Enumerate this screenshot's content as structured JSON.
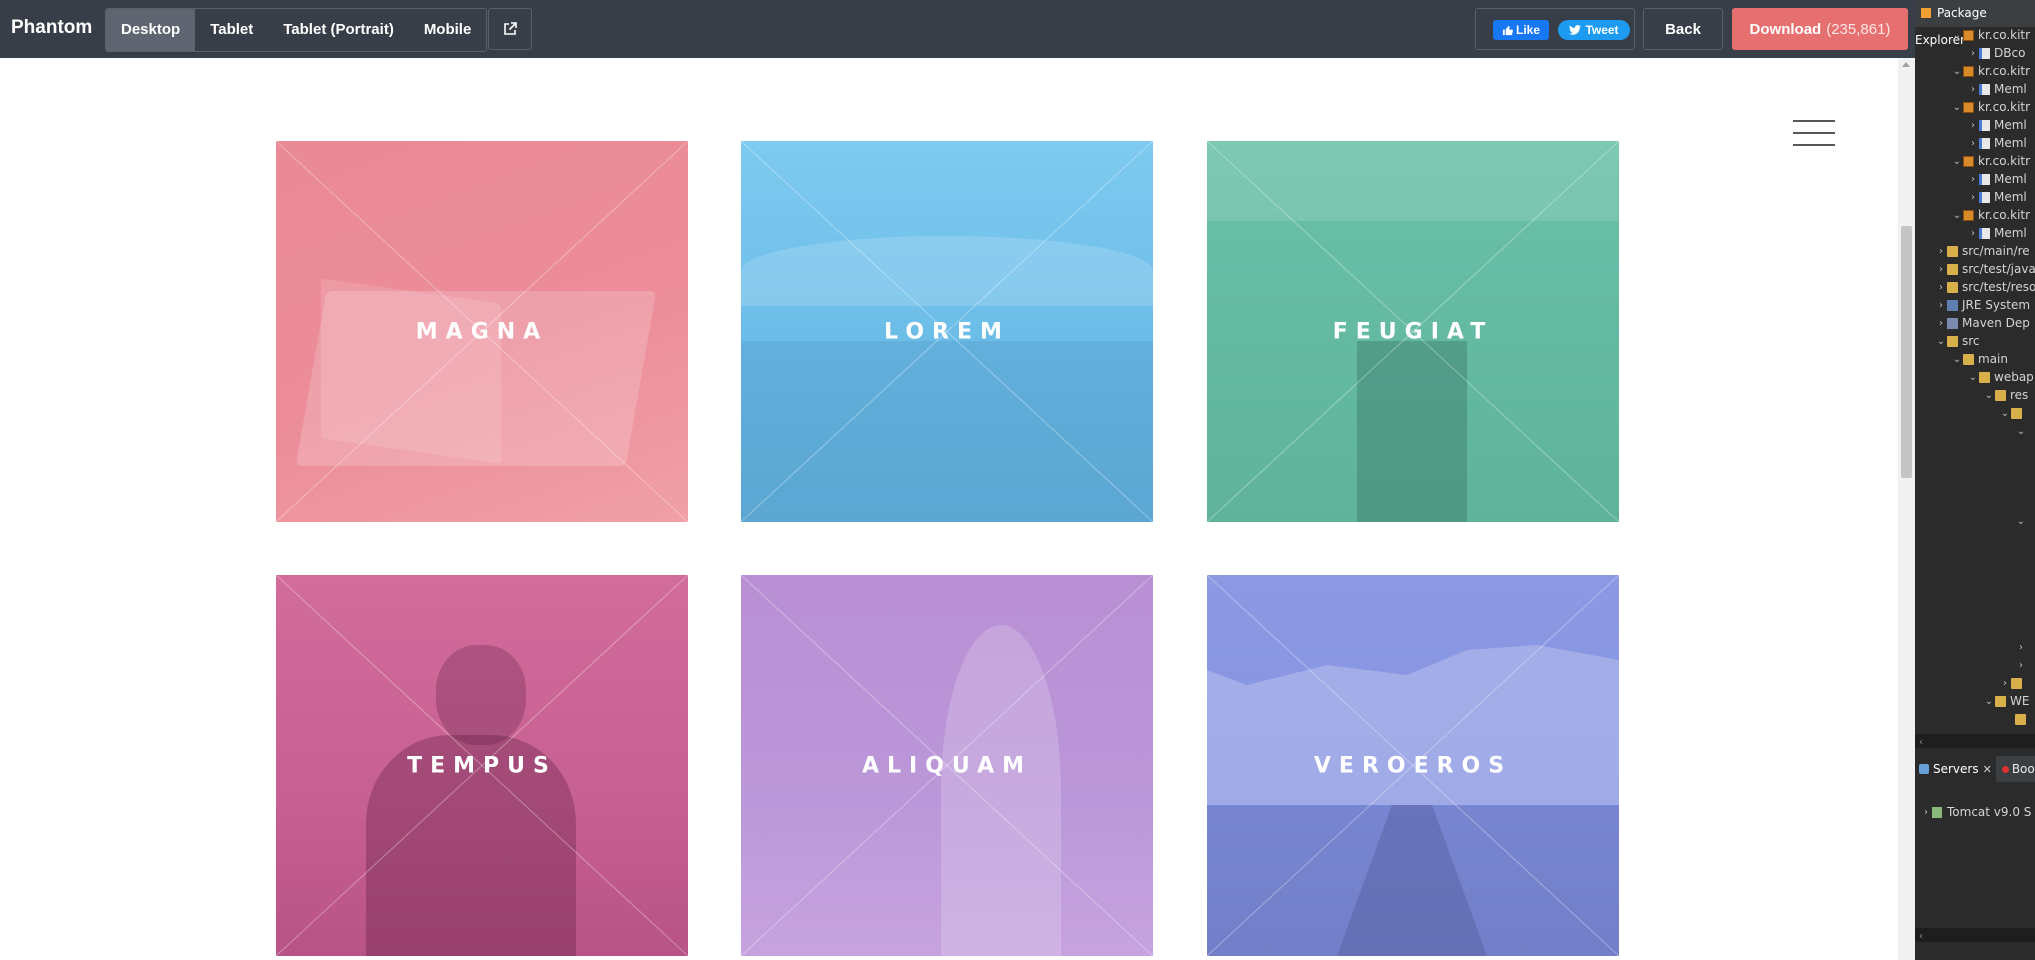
{
  "toolbar": {
    "brand": "Phantom",
    "devices": [
      {
        "label": "Desktop",
        "active": true
      },
      {
        "label": "Tablet",
        "active": false
      },
      {
        "label": "Tablet (Portrait)",
        "active": false
      },
      {
        "label": "Mobile",
        "active": false
      }
    ],
    "external_icon": "external-link-icon",
    "like_label": "Like",
    "tweet_label": "Tweet",
    "back_label": "Back",
    "download_label": "Download",
    "download_count": "(235,861)",
    "colors": {
      "bar": "#383e47",
      "download": "#e6706f",
      "like": "#1877f2",
      "tweet": "#1d9bf0"
    }
  },
  "preview": {
    "menu_icon": "hamburger-menu-icon",
    "tiles": [
      {
        "label": "MAGNA",
        "color": "#ec8d99"
      },
      {
        "label": "LOREM",
        "color": "#6cbde8"
      },
      {
        "label": "FEUGIAT",
        "color": "#5fb39b"
      },
      {
        "label": "TEMPUS",
        "color": "#c76092"
      },
      {
        "label": "ALIQUAM",
        "color": "#bb98d9"
      },
      {
        "label": "VEROEROS",
        "color": "#8593e0"
      }
    ]
  },
  "ide": {
    "package_explorer_title": "Package Explorer",
    "tree": [
      {
        "label": "kr.co.kitr",
        "icon": "package-icon",
        "expanded": true
      },
      {
        "label": "DBco",
        "icon": "java-file-icon",
        "expanded": false
      },
      {
        "label": "kr.co.kitr",
        "icon": "package-icon",
        "expanded": true
      },
      {
        "label": "Meml",
        "icon": "java-file-icon",
        "expanded": false
      },
      {
        "label": "kr.co.kitr",
        "icon": "package-icon",
        "expanded": true
      },
      {
        "label": "Meml",
        "icon": "java-file-icon",
        "expanded": false
      },
      {
        "label": "Meml",
        "icon": "java-file-icon",
        "expanded": false
      },
      {
        "label": "kr.co.kitr",
        "icon": "package-icon",
        "expanded": true
      },
      {
        "label": "Meml",
        "icon": "java-file-icon",
        "expanded": false
      },
      {
        "label": "Meml",
        "icon": "java-file-icon",
        "expanded": false
      },
      {
        "label": "kr.co.kitr",
        "icon": "package-icon",
        "expanded": true
      },
      {
        "label": "Meml",
        "icon": "java-file-icon",
        "expanded": false
      },
      {
        "label": "src/main/re",
        "icon": "folder-icon",
        "expanded": false
      },
      {
        "label": "src/test/java",
        "icon": "folder-icon",
        "expanded": false
      },
      {
        "label": "src/test/reso",
        "icon": "folder-icon",
        "expanded": false
      },
      {
        "label": "JRE System",
        "icon": "library-icon",
        "expanded": false
      },
      {
        "label": "Maven Dep",
        "icon": "library-icon",
        "expanded": false
      },
      {
        "label": "src",
        "icon": "folder-icon",
        "expanded": true
      },
      {
        "label": "main",
        "icon": "folder-icon",
        "expanded": true
      },
      {
        "label": "webap",
        "icon": "folder-icon",
        "expanded": true
      },
      {
        "label": "res",
        "icon": "folder-icon",
        "expanded": true
      }
    ],
    "webinf_label": "WE",
    "servers_tab": "Servers",
    "boot_tab": "Boo",
    "server_item": "Tomcat v9.0 S"
  }
}
